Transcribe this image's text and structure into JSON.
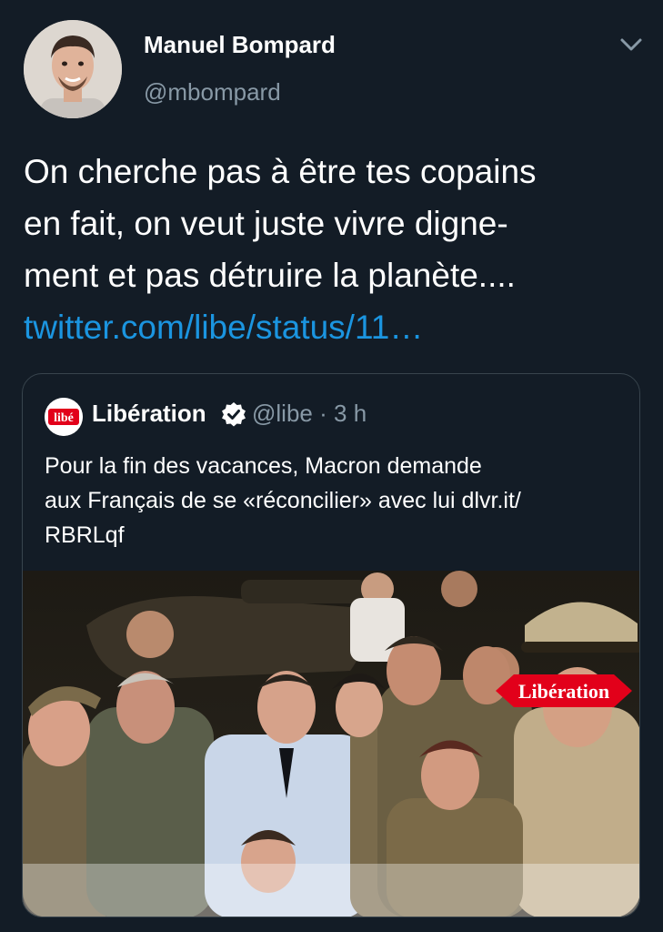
{
  "author": {
    "display_name": "Manuel Bompard",
    "handle": "@mbompard",
    "avatar_icon": "profile-photo",
    "menu_icon": "chevron-down-icon"
  },
  "tweet": {
    "lines": [
      "On cherche pas à être tes copains",
      "en fait, on veut juste vivre digne-",
      "ment et pas détruire la planète...."
    ],
    "link": "twitter.com/libe/status/11…",
    "link_color": "#1b95e0"
  },
  "quoted": {
    "name": "Libération",
    "handle": "@libe",
    "separator": "·",
    "time": "3 h",
    "lines": [
      "Pour la fin des vacances, Macron demande",
      "aux Français de se «réconcilier» avec lui dlvr.it/",
      "RBRLqf"
    ],
    "logo_text": "libé",
    "watermark": "Libération",
    "verified_icon": "verified-badge-icon"
  },
  "colors": {
    "background": "#131c26",
    "secondary_text": "#8899a6",
    "border": "#38444d",
    "liberation_red": "#e2001a"
  }
}
